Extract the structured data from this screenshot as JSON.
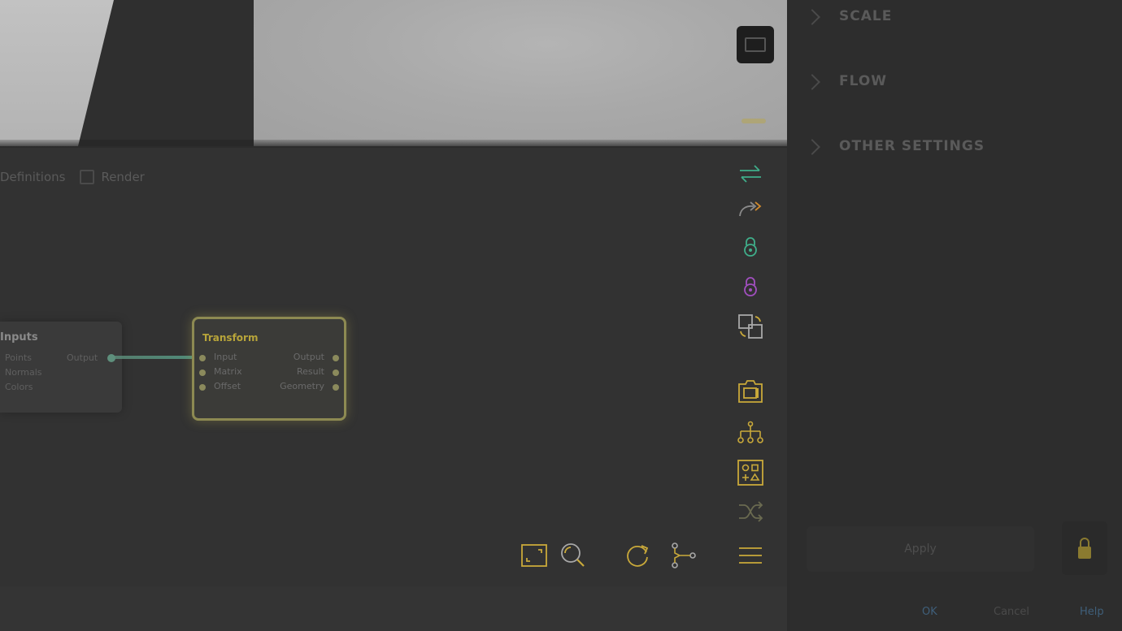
{
  "viewport": {
    "cube_button_icon": "view-cube-icon"
  },
  "editor": {
    "tabs": [
      {
        "label": "Definitions"
      },
      {
        "label": "Render"
      }
    ],
    "nodes": {
      "left": {
        "title": "Inputs",
        "ports": [
          "Points",
          "Normals",
          "Colors"
        ],
        "output": "Output"
      },
      "selected": {
        "title": "Transform",
        "inputs": [
          "Input",
          "Matrix",
          "Offset"
        ],
        "outputs": [
          "Output",
          "Result",
          "Geometry"
        ]
      }
    },
    "toolbar_right": [
      {
        "name": "swap-icon",
        "color": "#3fae8a"
      },
      {
        "name": "forward-icon",
        "color": "#d08a2e"
      },
      {
        "name": "lock-green-icon",
        "color": "#3fae8a"
      },
      {
        "name": "lock-purple-icon",
        "color": "#a24fc0"
      },
      {
        "name": "duplicate-icon",
        "color": "#a8a8a8"
      },
      {
        "name": "snapshot-icon",
        "color": "#c9a93a"
      },
      {
        "name": "hierarchy-icon",
        "color": "#c9a93a"
      },
      {
        "name": "shapes-icon",
        "color": "#c9a93a"
      },
      {
        "name": "shuffle-icon",
        "color": "#6a6a50"
      }
    ],
    "toolbar_bottom": [
      {
        "name": "fit-view-icon",
        "color": "#c9a93a"
      },
      {
        "name": "zoom-icon",
        "color": "#c9a93a"
      },
      {
        "name": "refresh-icon",
        "color": "#c9a93a"
      },
      {
        "name": "graph-icon",
        "color": "#c9a93a"
      },
      {
        "name": "menu-icon",
        "color": "#c9a93a"
      }
    ]
  },
  "panel": {
    "sections": [
      {
        "label": "SCALE"
      },
      {
        "label": "FLOW"
      },
      {
        "label": "OTHER SETTINGS"
      }
    ],
    "action_label": "Apply",
    "footer": {
      "left": "OK",
      "middle": "Cancel",
      "right": "Help"
    }
  }
}
